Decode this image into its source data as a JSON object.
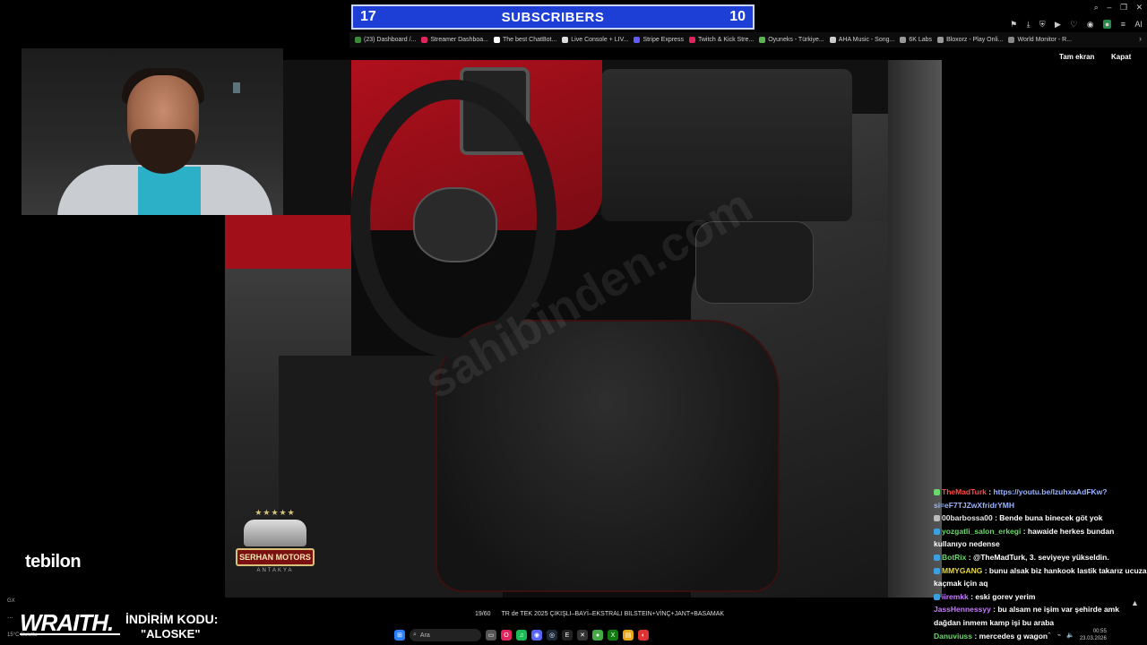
{
  "subscriber_banner": {
    "left_count": "17",
    "title": "SUBSCRIBERS",
    "right_count": "10"
  },
  "bookmarks": [
    {
      "label": "(23) Dashboard /...",
      "color": "#3b8a3b"
    },
    {
      "label": "Streamer Dashboa...",
      "color": "#e0245e"
    },
    {
      "label": "The best ChatBot...",
      "color": "#ffffff"
    },
    {
      "label": "Live Console + LIV...",
      "color": "#dddddd"
    },
    {
      "label": "Stripe Express",
      "color": "#635bff"
    },
    {
      "label": "Twitch & Kick Stre...",
      "color": "#e0245e"
    },
    {
      "label": "Oyuneks - Türkiye...",
      "color": "#5ab552"
    },
    {
      "label": "AHA Music - Song...",
      "color": "#cccccc"
    },
    {
      "label": "6K Labs",
      "color": "#999999"
    },
    {
      "label": "Bloxorz - Play Onli...",
      "color": "#999999"
    },
    {
      "label": "World Monitor - R...",
      "color": "#888888"
    }
  ],
  "viewer": {
    "fullscreen": "Tam ekran",
    "close": "Kapat"
  },
  "photo": {
    "watermark": "sahibinden.com",
    "dealer_logo": {
      "stars": "★★★★★",
      "name": "SERHAN MOTORS",
      "subtitle": "ANTAKYA"
    }
  },
  "caption": {
    "counter": "19/60",
    "text": "TR de TEK 2025 ÇIKIŞLI–BAYİ–EKSTRALI BILSTEIN+VİNÇ+JANT+BASAMAK"
  },
  "branding": {
    "tebilon": "tebilon",
    "wraith": "WRAITH.",
    "promo_label": "İNDİRİM KODU:",
    "promo_code": "\"ALOSKE\""
  },
  "left_misc": {
    "gx": "GX",
    "dots": "...",
    "weather": "15°C Bulutlu"
  },
  "chat": [
    {
      "user": "TheMadTurk",
      "color": "#ff4a4a",
      "text": "https://youtu.be/IzuhxaAdFKw?si=eF7TJZwXfridrYMH",
      "link": true
    },
    {
      "user": "00barbossa00",
      "color": "#e6e6e6",
      "text": "Bende buna binecek göt yok"
    },
    {
      "user": "yozgatli_salon_erkegi",
      "color": "#6bd96b",
      "text": "hawaide herkes bundan kullanıyo nedense"
    },
    {
      "user": "BotRix",
      "color": "#6bd96b",
      "text": "@TheMadTurk, 3. seviyeye yükseldin."
    },
    {
      "user": "MMYGANG",
      "color": "#e8d84a",
      "text": "bunu alsak biz hankook lastik takarız ucuza kaçmak için aq"
    },
    {
      "user": "iiremkk",
      "color": "#c77dff",
      "text": "eski gorev yerim"
    },
    {
      "user": "JassHennessyy",
      "color": "#c77dff",
      "text": "bu alsam ne işim var şehirde amk dağdan inmem kamp işi bu araba"
    },
    {
      "user": "Danuviuss",
      "color": "#6bd96b",
      "text": "mercedes g wagon"
    }
  ],
  "taskbar": {
    "search_placeholder": "Ara"
  },
  "tray": {
    "time": "00:55",
    "date": "23.03.2026"
  },
  "colors": {
    "banner_bg": "#1e3fd6",
    "accent_red": "#a10f19"
  }
}
